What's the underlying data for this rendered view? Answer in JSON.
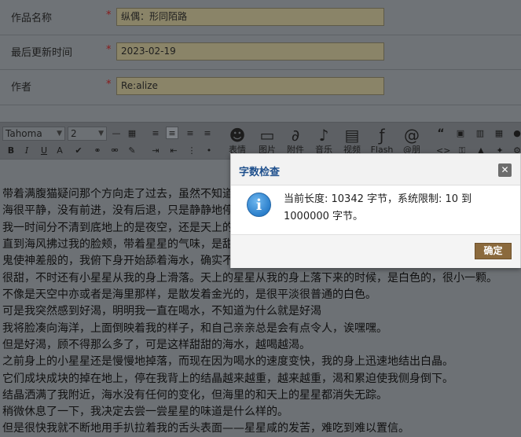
{
  "form": {
    "fields": [
      {
        "label": "作品名称",
        "required_mark": "*",
        "value": "纵偶：形同陌路"
      },
      {
        "label": "最后更新时间",
        "required_mark": "*",
        "value": "2023-02-19"
      },
      {
        "label": "作者",
        "required_mark": "*",
        "value": "Re:alize"
      }
    ]
  },
  "toolbar": {
    "font_family": "Tahoma",
    "font_size": "2",
    "buttons": {
      "emoji": "表情",
      "image": "图片",
      "attachment": "附件",
      "music": "音乐",
      "video": "视频",
      "flash": "Flash",
      "mention": "@朋"
    },
    "bold": "B",
    "italic": "I",
    "underline": "U",
    "quote": "“"
  },
  "editor": {
    "lines": [
      "带着满腹猫疑问那个方向走了过去，虽然不知道",
      "海很平静，没有前进，没有后退，只是静静地停",
      "我一时间分不清到底地上的是夜空，还是天上的",
      "直到海风拂过我的脸颊，带着星星的气味，是甜",
      "鬼使神差般的，我俯下身开始舔着海水，确实不",
      "很甜，不时还有小星星从我的身上滑落。天上的星星从我的身上落下来的时候，是白色的，很小一颗。",
      "不像是天空中亦或者是海里那样，是散发着金光的，是很平淡很普通的白色。",
      "可是我突然感到好渴，明明我一直在喝水，不知道为什么就是好渴",
      "我将脸凑向海洋，上面倒映着我的样子，和自己亲亲总是会有点令人，诶嘿嘿。",
      "但是好渴，顾不得那么多了，可是这样甜甜的海水，越喝越渴。",
      "之前身上的小星星还是慢慢地掉落，而现在因为喝水的速度变快，我的身上迅速地结出白晶。",
      "它们成块成块的掉在地上，停在我背上的结晶越来越重，越来越重，渴和累迫使我侧身倒下。",
      "结晶洒满了我附近，海水没有任何的变化，但海里的和天上的星星都消失无踪。",
      "稍微休息了一下，我决定去尝一尝星星的味道是什么样的。",
      "但是很快我就不断地用手扒拉着我的舌头表面——星星咸的发苦，难吃到难以置信。"
    ]
  },
  "dialog": {
    "title": "字数检查",
    "message": "当前长度: 10342 字节，系统限制: 10 到 1000000 字节。",
    "ok_label": "确定",
    "close_glyph": "✕"
  }
}
